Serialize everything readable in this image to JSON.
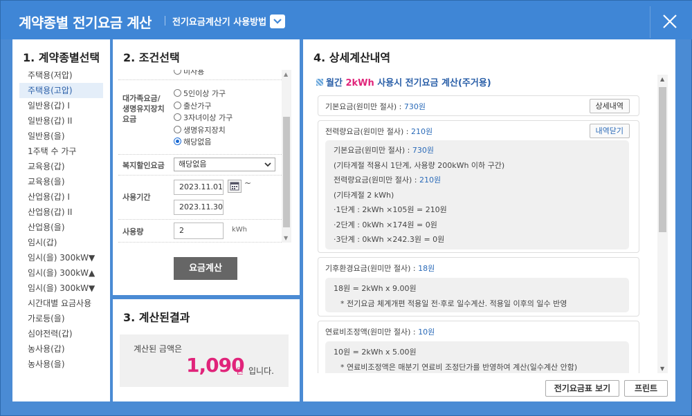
{
  "header": {
    "title": "계약종별 전기요금 계산",
    "usage_link": "전기요금계산기 사용방법"
  },
  "panel1": {
    "title": "1. 계약종별선택",
    "items": [
      "주택용(저압)",
      "주택용(고압)",
      "일반용(갑) I",
      "일반용(갑) II",
      "일반용(을)",
      "1주택 수 가구",
      "교육용(갑)",
      "교육용(을)",
      "산업용(갑) I",
      "산업용(갑) II",
      "산업용(을)",
      "임시(갑)",
      "임시(을) 300kW▼",
      "임시(을) 300kW▲",
      "임시(을) 300kW▼",
      "시간대별 요금사용",
      "가로등(을)",
      "심야전력(갑)",
      "농사용(갑)",
      "농사용(을)"
    ],
    "selected": "주택용(고압)"
  },
  "panel2": {
    "title": "2. 조건선택",
    "partial_option": "미사용",
    "discount_label": "대가족요금/\n생명유지장치\n요금",
    "discount_options": [
      "5인이상 가구",
      "출산가구",
      "3자녀이상 가구",
      "생명유지장치",
      "해당없음"
    ],
    "discount_selected": "해당없음",
    "welfare_label": "복지할인요금",
    "welfare_value": "해당없음",
    "period_label": "사용기간",
    "start_date": "2023.11.01",
    "end_date": "2023.11.30",
    "tilde": "~",
    "usage_label": "사용량",
    "usage_value": "2",
    "usage_unit": "kWh",
    "calc_button": "요금계산"
  },
  "panel3": {
    "title": "3. 계산된결과",
    "label": "계산된 금액은",
    "amount": "1,090",
    "won": "원",
    "suffix": "입니다."
  },
  "panel4": {
    "title": "4. 상세계산내역",
    "headline_pre": "월간 ",
    "headline_hi": "2kWh",
    "headline_post": " 사용시 전기요금 계산(주거용)",
    "base": {
      "label": "기본요금(원미만 절사) : ",
      "value": "730원",
      "button": "상세내역"
    },
    "energy": {
      "label": "전력량요금(원미만 절사) : ",
      "value": "210원",
      "button": "내역닫기",
      "lines": [
        {
          "text": "기본요금(원미만 절사) : ",
          "value": "730원"
        },
        {
          "text": "(기타계절 적용시 1단계, 사용량 200kWh 이하 구간)",
          "value": ""
        },
        {
          "text": "전력량요금(원미만 절사) : ",
          "value": "210원"
        },
        {
          "text": "(기타계절 2 kWh)",
          "value": ""
        },
        {
          "text": "·1단계 : 2kWh ×105원 = 210원",
          "value": ""
        },
        {
          "text": "·2단계 : 0kWh ×174원 = 0원",
          "value": ""
        },
        {
          "text": "·3단계 : 0kWh ×242.3원 = 0원",
          "value": ""
        }
      ]
    },
    "climate": {
      "label": "기후환경요금(원미만 절사) : ",
      "value": "18원",
      "line1": "18원 = 2kWh x 9.00원",
      "line2": "* 전기요금 체계개편 적용일 전·후로 일수계산. 적용일 이후의 일수 반영"
    },
    "fuel": {
      "label": "연료비조정액(원미만 절사) : ",
      "value": "10원",
      "line1": "10원 = 2kWh x 5.00원",
      "line2": "* 연료비조정액은 매분기 연료비 조정단가를 반영하여 계산(일수계산 안함)"
    },
    "rate_table_button": "전기요금표 보기",
    "print_button": "프린트"
  }
}
